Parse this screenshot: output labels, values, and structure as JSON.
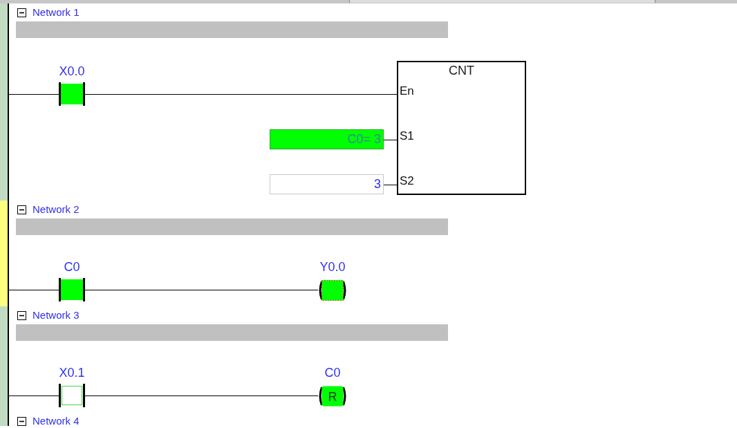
{
  "networks": [
    {
      "title": "Network 1",
      "expanded": true,
      "selected": false,
      "rung": {
        "elements": [
          {
            "kind": "contact",
            "label": "X0.0",
            "on": true
          },
          {
            "kind": "block",
            "name": "CNT",
            "pins": [
              {
                "name": "En"
              },
              {
                "name": "S1",
                "operand": "C0= 3",
                "on": true
              },
              {
                "name": "S2",
                "operand": "3",
                "on": false
              }
            ]
          }
        ]
      }
    },
    {
      "title": "Network 2",
      "expanded": true,
      "selected": true,
      "rung": {
        "elements": [
          {
            "kind": "contact",
            "label": "C0",
            "on": true
          },
          {
            "kind": "coil",
            "label": "Y0.0",
            "on": true
          }
        ]
      }
    },
    {
      "title": "Network 3",
      "expanded": true,
      "selected": false,
      "rung": {
        "elements": [
          {
            "kind": "contact",
            "label": "X0.1",
            "on": false
          },
          {
            "kind": "coil",
            "label": "C0",
            "on": true,
            "letter": "R"
          }
        ]
      }
    },
    {
      "title": "Network 4",
      "expanded": true,
      "selected": false
    }
  ]
}
